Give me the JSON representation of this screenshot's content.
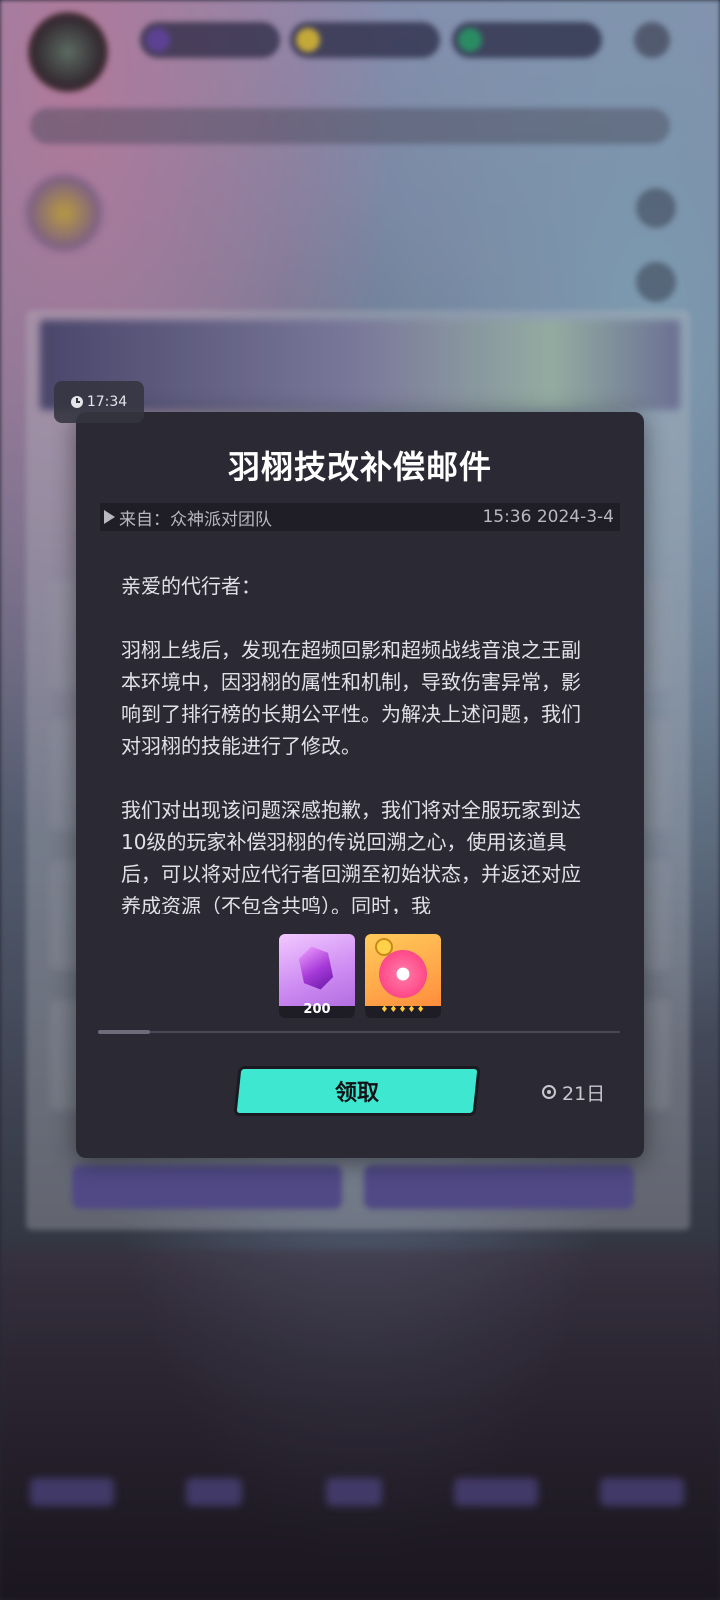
{
  "time_chip": {
    "text": "17:34",
    "icon": "clock-icon"
  },
  "mail": {
    "title": "羽栩技改补偿邮件",
    "sender": "来自：众神派对团队",
    "sent_at": "15:36 2024-3-4",
    "greeting": "亲爱的代行者：",
    "paragraphs": [
      "羽栩上线后，发现在超频回影和超频战线音浪之王副本环境中，因羽栩的属性和机制，导致伤害异常，影响到了排行榜的长期公平性。为解决上述问题，我们对羽栩的技能进行了修改。",
      "我们对出现该问题深感抱歉，我们将对全服玩家到达10级的玩家补偿羽栩的传说回溯之心，使用该道具后，可以将对应代行者回溯至初始状态，并返还对应养成资源（不包含共鸣）。同时，我"
    ],
    "rewards": [
      {
        "icon": "purple-gem-icon",
        "quantity": "200"
      },
      {
        "icon": "rewind-heart-icon",
        "stars": "♦♦♦♦♦"
      }
    ],
    "scroll_progress": 0.1,
    "claim_label": "领取",
    "expire_text": "21日",
    "expire_icon": "timer-icon"
  },
  "colors": {
    "dialog_bg": "#2b2934",
    "claim_button": "#3ee8d0",
    "title_text": "#ffffff"
  }
}
